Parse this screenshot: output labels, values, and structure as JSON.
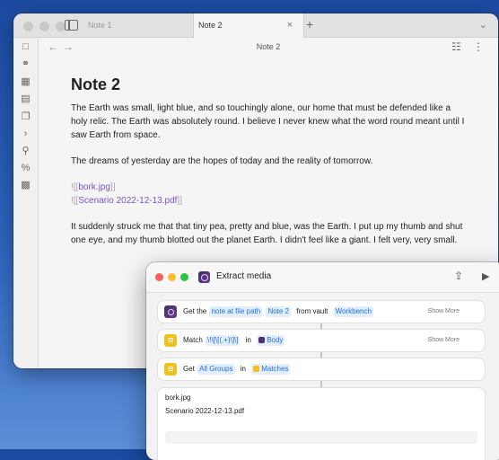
{
  "note_window": {
    "tabs": [
      {
        "label": "Note 1"
      },
      {
        "label": "Note 2",
        "close": "×"
      }
    ],
    "new_tab": "+",
    "tab_menu": "⌄",
    "nav": {
      "back": "←",
      "forward": "→",
      "title": "Note 2"
    },
    "content": {
      "heading": "Note 2",
      "paragraph1": "The Earth was small, light blue, and so touchingly alone, our home that must be defended like a holy relic. The Earth was absolutely round. I believe I never knew what the word round meant until I saw Earth from space.",
      "paragraph2": "The dreams of yesterday are the hopes of today and the reality of tomorrow.",
      "embed1": {
        "open": "![[",
        "name": "bork.jpg",
        "close": "]]"
      },
      "embed2": {
        "open": "![[",
        "name": "Scenario 2022-12-13.pdf",
        "close": "]]"
      },
      "paragraph3": "It suddenly struck me that that tiny pea, pretty and blue, was the Earth. I put up my thumb and shut one eye, and my thumb blotted out the planet Earth. I didn't feel like a giant. I felt very, very small."
    }
  },
  "shortcut_window": {
    "title": "Extract media",
    "actions": [
      {
        "get": "Get the",
        "token1": "note at file path",
        "token2": "Note 2",
        "from": "from vault",
        "token3": "Workbench",
        "show_more": "Show More"
      },
      {
        "match": "Match",
        "pattern": "\\!\\[\\[(.+)\\]\\]",
        "in": "in",
        "body": "Body",
        "show_more": "Show More"
      },
      {
        "get": "Get",
        "groups": "All Groups",
        "in": "in",
        "matches": "Matches"
      }
    ],
    "results": [
      "bork.jpg",
      "Scenario 2022-12-13.pdf"
    ]
  }
}
